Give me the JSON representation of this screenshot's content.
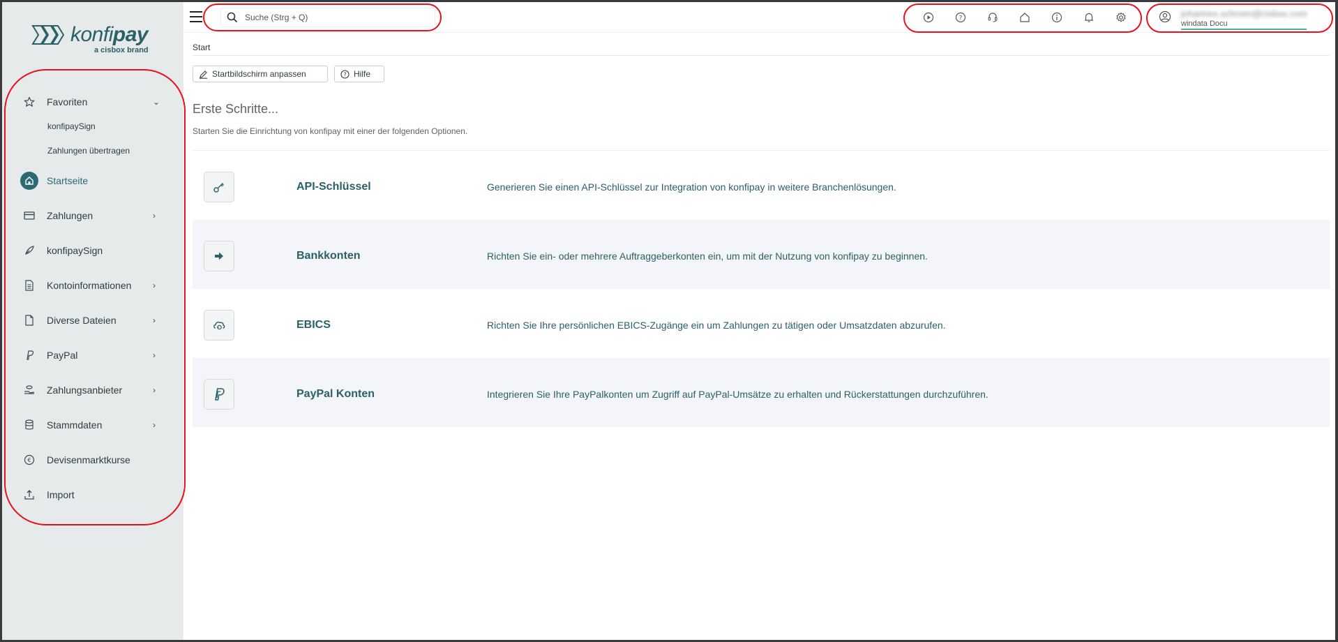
{
  "logo": {
    "name_light": "konfi",
    "name_bold": "pay",
    "tagline": "a cisbox brand"
  },
  "search": {
    "placeholder": "Suche (Strg + Q)"
  },
  "toolbar_icons": [
    "play-icon",
    "help-icon",
    "support-icon",
    "home-icon",
    "info-icon",
    "bell-icon",
    "settings-icon"
  ],
  "user": {
    "email": "johannes.schroen@cisbox.com",
    "org": "windata Docu"
  },
  "sidebar": {
    "favorites_label": "Favoriten",
    "favorites": [
      "konfipaySign",
      "Zahlungen übertragen"
    ],
    "items": [
      {
        "label": "Startseite",
        "icon": "home-icon",
        "active": true
      },
      {
        "label": "Zahlungen",
        "icon": "card-icon",
        "chevron": true
      },
      {
        "label": "konfipaySign",
        "icon": "feather-icon"
      },
      {
        "label": "Kontoinformationen",
        "icon": "document-icon",
        "chevron": true
      },
      {
        "label": "Diverse Dateien",
        "icon": "file-icon",
        "chevron": true
      },
      {
        "label": "PayPal",
        "icon": "paypal-icon",
        "chevron": true
      },
      {
        "label": "Zahlungsanbieter",
        "icon": "coins-icon",
        "chevron": true
      },
      {
        "label": "Stammdaten",
        "icon": "database-icon",
        "chevron": true
      },
      {
        "label": "Devisenmarktkurse",
        "icon": "euro-icon"
      },
      {
        "label": "Import",
        "icon": "upload-icon"
      }
    ]
  },
  "breadcrumb": "Start",
  "actions": {
    "customize": "Startbildschirm anpassen",
    "help": "Hilfe"
  },
  "main": {
    "title": "Erste Schritte...",
    "subtitle": "Starten Sie die Einrichtung von konfipay mit einer der folgenden Optionen.",
    "cards": [
      {
        "title": "API-Schlüssel",
        "icon": "key-icon",
        "description": "Generieren Sie einen API-Schlüssel zur Integration von konfipay in weitere Branchenlösungen."
      },
      {
        "title": "Bankkonten",
        "icon": "arrow-right-icon",
        "description": "Richten Sie ein- oder mehrere Auftraggeberkonten ein, um mit der Nutzung von konfipay zu beginnen."
      },
      {
        "title": "EBICS",
        "icon": "cloud-sync-icon",
        "description": "Richten Sie Ihre persönlichen EBICS-Zugänge ein um Zahlungen zu tätigen oder Umsatzdaten abzurufen."
      },
      {
        "title": "PayPal Konten",
        "icon": "paypal-icon",
        "description": "Integrieren Sie Ihre PayPalkonten um Zugriff auf PayPal-Umsätze zu erhalten und Rückerstattungen durchzuführen."
      }
    ]
  },
  "colors": {
    "brand": "#2a6068",
    "sidebar_bg": "#e6eaea",
    "annotation": "#e8101a",
    "alt_row": "#f3f5f8"
  }
}
